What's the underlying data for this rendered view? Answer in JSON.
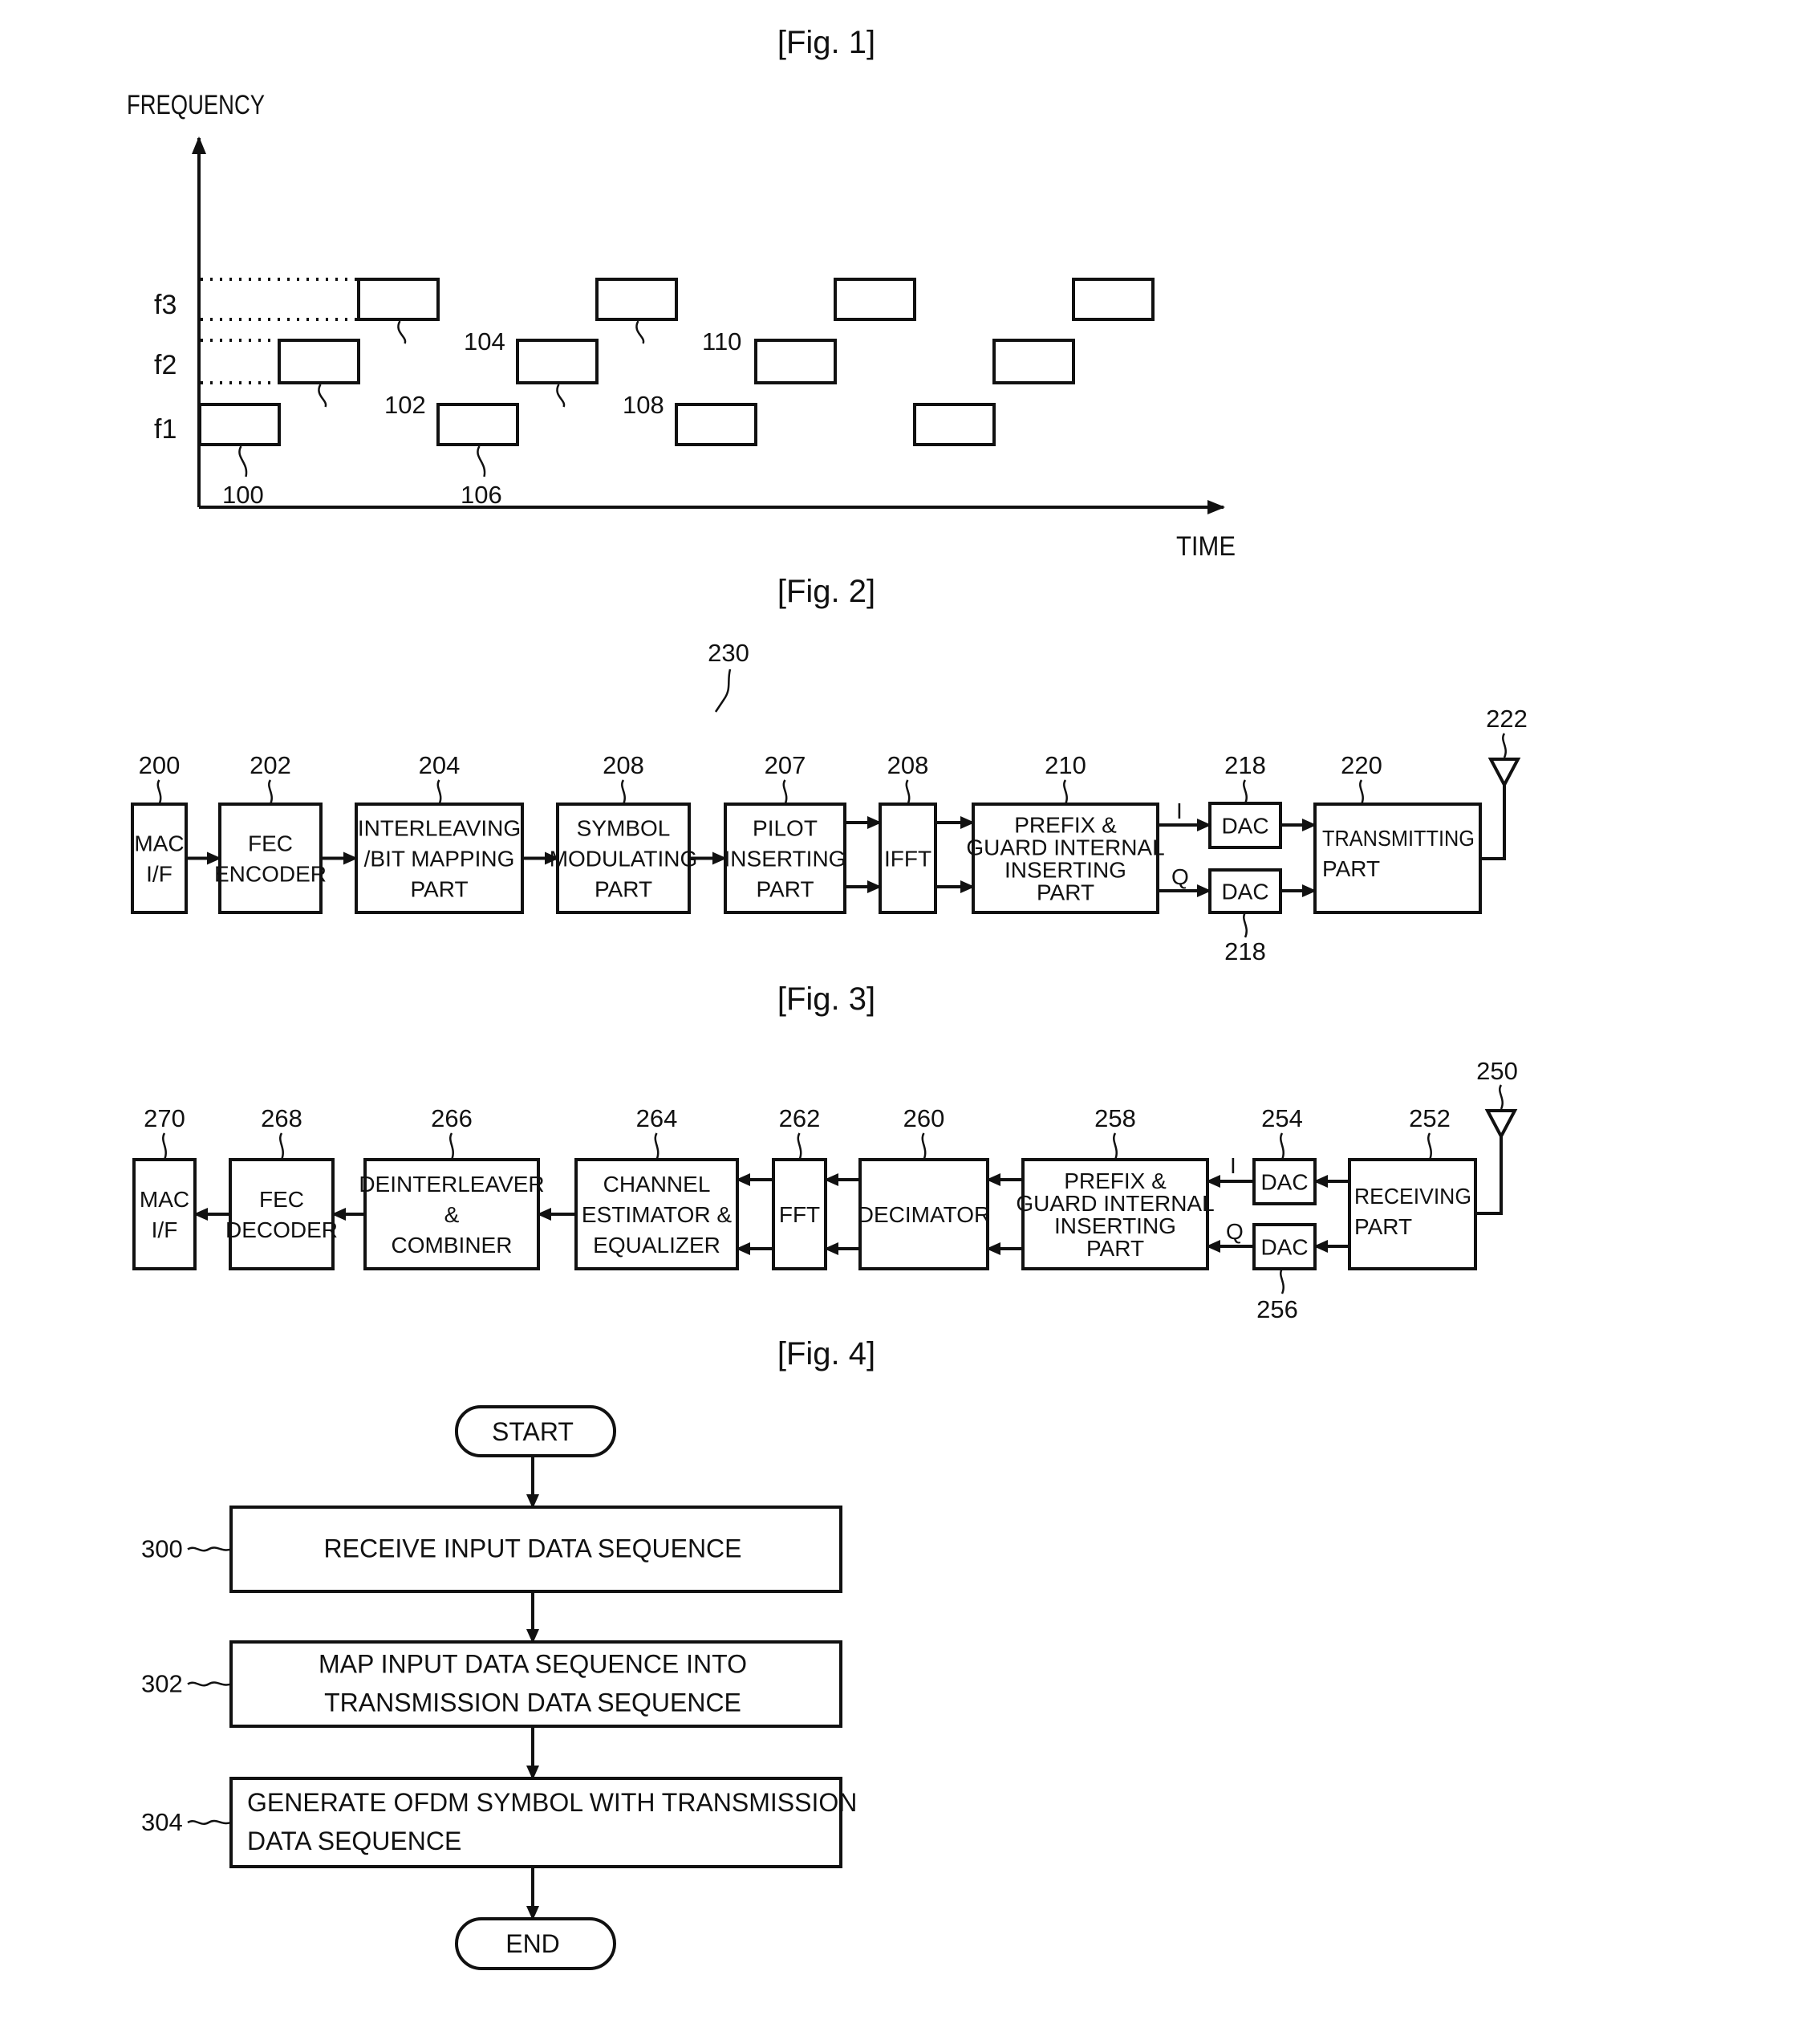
{
  "figures": {
    "fig1": {
      "title": "[Fig. 1]",
      "y_axis_label": "FREQUENCY",
      "x_axis_label": "TIME",
      "freq_labels": [
        "f1",
        "f2",
        "f3"
      ],
      "hop_pattern": [
        {
          "slot": 0,
          "freq": "f1",
          "ref": "100"
        },
        {
          "slot": 1,
          "freq": "f2",
          "ref": "102"
        },
        {
          "slot": 2,
          "freq": "f3",
          "ref": "104"
        },
        {
          "slot": 3,
          "freq": "f1",
          "ref": "106"
        },
        {
          "slot": 4,
          "freq": "f2",
          "ref": "108"
        },
        {
          "slot": 5,
          "freq": "f3",
          "ref": "110"
        },
        {
          "slot": 6,
          "freq": "f1",
          "ref": ""
        },
        {
          "slot": 7,
          "freq": "f2",
          "ref": ""
        },
        {
          "slot": 8,
          "freq": "f3",
          "ref": ""
        },
        {
          "slot": 9,
          "freq": "f1",
          "ref": ""
        },
        {
          "slot": 10,
          "freq": "f2",
          "ref": ""
        },
        {
          "slot": 11,
          "freq": "f3",
          "ref": ""
        }
      ]
    },
    "fig2": {
      "title": "[Fig. 2]",
      "system_ref": "230",
      "antenna_ref": "222",
      "blocks": [
        {
          "ref": "200",
          "lines": [
            "MAC",
            "I/F"
          ]
        },
        {
          "ref": "202",
          "lines": [
            "FEC",
            "ENCODER"
          ]
        },
        {
          "ref": "204",
          "lines": [
            "INTERLEAVING",
            "/BIT MAPPING",
            "PART"
          ]
        },
        {
          "ref": "208",
          "lines": [
            "SYMBOL",
            "MODULATING",
            "PART"
          ]
        },
        {
          "ref": "207",
          "lines": [
            "PILOT",
            "INSERTING",
            "PART"
          ]
        },
        {
          "ref": "208",
          "lines": [
            "IFFT"
          ]
        },
        {
          "ref": "210",
          "lines": [
            "PREFIX &",
            "GUARD INTERNAL",
            "INSERTING",
            "PART"
          ]
        },
        {
          "ref": "218",
          "lines": [
            "DAC"
          ]
        },
        {
          "ref": "218",
          "lines": [
            "DAC"
          ]
        },
        {
          "ref": "220",
          "lines": [
            "TRANSMITTING",
            "PART"
          ]
        }
      ],
      "i_label": "I",
      "q_label": "Q"
    },
    "fig3": {
      "title": "[Fig. 3]",
      "antenna_ref": "250",
      "blocks": [
        {
          "ref": "270",
          "lines": [
            "MAC",
            "I/F"
          ]
        },
        {
          "ref": "268",
          "lines": [
            "FEC",
            "DECODER"
          ]
        },
        {
          "ref": "266",
          "lines": [
            "DEINTERLEAVER",
            "&",
            "COMBINER"
          ]
        },
        {
          "ref": "264",
          "lines": [
            "CHANNEL",
            "ESTIMATOR &",
            "EQUALIZER"
          ]
        },
        {
          "ref": "262",
          "lines": [
            "FFT"
          ]
        },
        {
          "ref": "260",
          "lines": [
            "DECIMATOR"
          ]
        },
        {
          "ref": "258",
          "lines": [
            "PREFIX &",
            "GUARD INTERNAL",
            "INSERTING",
            "PART"
          ]
        },
        {
          "ref": "254",
          "lines": [
            "DAC"
          ]
        },
        {
          "ref": "256",
          "lines": [
            "DAC"
          ]
        },
        {
          "ref": "252",
          "lines": [
            "RECEIVING",
            "PART"
          ]
        }
      ],
      "i_label": "I",
      "q_label": "Q"
    },
    "fig4": {
      "title": "[Fig. 4]",
      "start_label": "START",
      "end_label": "END",
      "steps": [
        {
          "ref": "300",
          "lines": [
            "RECEIVE INPUT DATA SEQUENCE"
          ]
        },
        {
          "ref": "302",
          "lines": [
            "MAP INPUT DATA SEQUENCE INTO",
            "TRANSMISSION DATA SEQUENCE"
          ]
        },
        {
          "ref": "304",
          "lines": [
            "GENERATE OFDM SYMBOL WITH TRANSMISSION",
            "DATA SEQUENCE"
          ]
        }
      ]
    }
  }
}
